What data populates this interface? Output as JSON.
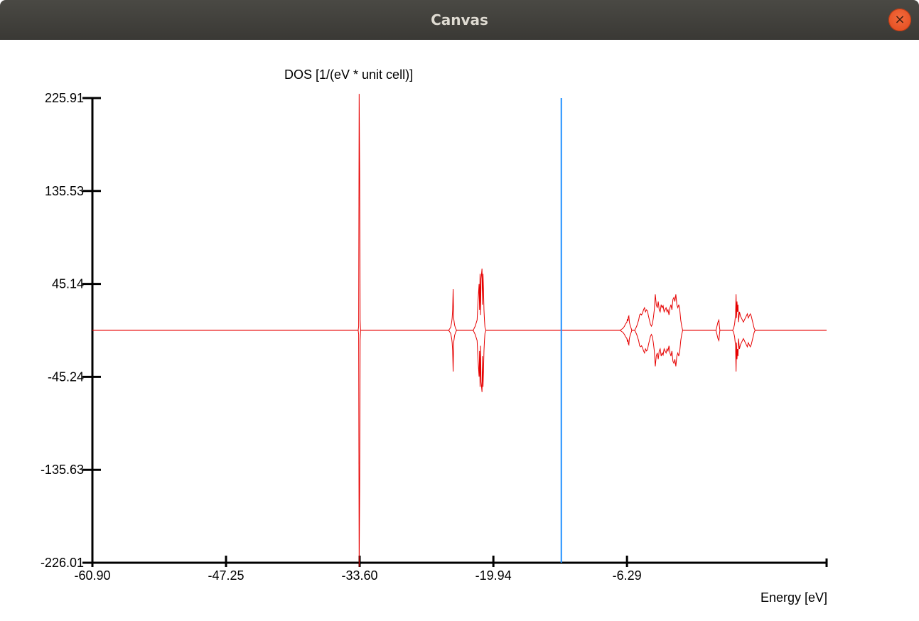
{
  "window": {
    "title": "Canvas",
    "close_icon": "close-icon",
    "close_glyph": "×"
  },
  "colors": {
    "titlebar": "#3d3c38",
    "close_button": "#e95420",
    "dos_curve": "#e60000",
    "fermi_line": "#1e90ff",
    "axis": "#000000"
  },
  "chart_data": {
    "type": "line",
    "title": "",
    "ylabel": "DOS [1/(eV * unit cell)]",
    "xlabel": "Energy [eV]",
    "xlim": [
      -60.9,
      14.1
    ],
    "ylim": [
      -226.01,
      225.91
    ],
    "x_ticks": [
      -60.9,
      -47.25,
      -33.6,
      -19.94,
      -6.29
    ],
    "x_tick_labels": [
      "-60.90",
      "-47.25",
      "-33.60",
      "-19.94",
      "-6.29"
    ],
    "y_ticks": [
      225.91,
      135.53,
      45.14,
      -45.24,
      -135.63,
      -226.01
    ],
    "y_tick_labels": [
      "225.91",
      "135.53",
      "45.14",
      "-45.24",
      "-135.63",
      "-226.01"
    ],
    "grid": false,
    "fermi_level": {
      "x": -13.0,
      "color": "#1e90ff"
    },
    "series": [
      {
        "color": "#e60000",
        "spin_up": [
          [
            -60.9,
            0
          ],
          [
            -33.75,
            0
          ],
          [
            -33.7,
            4
          ],
          [
            -33.65,
            230
          ],
          [
            -33.6,
            155
          ],
          [
            -33.55,
            10
          ],
          [
            -33.5,
            0
          ],
          [
            -24.5,
            0
          ],
          [
            -24.3,
            3
          ],
          [
            -24.2,
            8
          ],
          [
            -24.15,
            12
          ],
          [
            -24.1,
            20
          ],
          [
            -24.05,
            40
          ],
          [
            -24.0,
            12
          ],
          [
            -23.9,
            5
          ],
          [
            -23.8,
            2
          ],
          [
            -23.7,
            0
          ],
          [
            -22.0,
            0
          ],
          [
            -21.8,
            4
          ],
          [
            -21.6,
            10
          ],
          [
            -21.5,
            30
          ],
          [
            -21.4,
            45
          ],
          [
            -21.35,
            20
          ],
          [
            -21.3,
            55
          ],
          [
            -21.25,
            15
          ],
          [
            -21.2,
            50
          ],
          [
            -21.1,
            60
          ],
          [
            -21.05,
            25
          ],
          [
            -21.0,
            55
          ],
          [
            -20.95,
            40
          ],
          [
            -20.9,
            20
          ],
          [
            -20.85,
            10
          ],
          [
            -20.8,
            3
          ],
          [
            -20.7,
            0
          ],
          [
            -7.0,
            0
          ],
          [
            -6.85,
            1
          ],
          [
            -6.7,
            2
          ],
          [
            -6.55,
            4
          ],
          [
            -6.45,
            6
          ],
          [
            -6.3,
            8
          ],
          [
            -6.25,
            11
          ],
          [
            -6.2,
            9
          ],
          [
            -6.15,
            13
          ],
          [
            -6.1,
            14
          ],
          [
            -6.05,
            8
          ],
          [
            -6.0,
            6
          ],
          [
            -5.9,
            3
          ],
          [
            -5.8,
            0
          ],
          [
            -5.5,
            0
          ],
          [
            -5.3,
            4
          ],
          [
            -5.1,
            10
          ],
          [
            -5.0,
            15
          ],
          [
            -4.9,
            16
          ],
          [
            -4.8,
            15
          ],
          [
            -4.7,
            17
          ],
          [
            -4.6,
            20
          ],
          [
            -4.5,
            22
          ],
          [
            -4.4,
            18
          ],
          [
            -4.3,
            20
          ],
          [
            -4.2,
            19
          ],
          [
            -4.1,
            14
          ],
          [
            -4.0,
            10
          ],
          [
            -3.9,
            6
          ],
          [
            -3.8,
            4
          ],
          [
            -3.7,
            6
          ],
          [
            -3.6,
            12
          ],
          [
            -3.5,
            20
          ],
          [
            -3.4,
            35
          ],
          [
            -3.3,
            25
          ],
          [
            -3.2,
            22
          ],
          [
            -3.1,
            28
          ],
          [
            -3.0,
            20
          ],
          [
            -2.9,
            18
          ],
          [
            -2.8,
            25
          ],
          [
            -2.7,
            22
          ],
          [
            -2.6,
            24
          ],
          [
            -2.5,
            18
          ],
          [
            -2.4,
            20
          ],
          [
            -2.3,
            22
          ],
          [
            -2.2,
            18
          ],
          [
            -2.1,
            20
          ],
          [
            -2.0,
            15
          ],
          [
            -1.9,
            22
          ],
          [
            -1.8,
            25
          ],
          [
            -1.7,
            20
          ],
          [
            -1.6,
            30
          ],
          [
            -1.5,
            32
          ],
          [
            -1.4,
            28
          ],
          [
            -1.3,
            35
          ],
          [
            -1.2,
            25
          ],
          [
            -1.1,
            22
          ],
          [
            -1.0,
            25
          ],
          [
            -0.9,
            20
          ],
          [
            -0.8,
            10
          ],
          [
            -0.7,
            4
          ],
          [
            -0.6,
            0
          ],
          [
            2.8,
            0
          ],
          [
            2.9,
            4
          ],
          [
            3.0,
            8
          ],
          [
            3.1,
            10
          ],
          [
            3.15,
            4
          ],
          [
            3.2,
            0
          ],
          [
            4.5,
            0
          ],
          [
            4.6,
            2
          ],
          [
            4.7,
            6
          ],
          [
            4.8,
            15
          ],
          [
            4.85,
            35
          ],
          [
            4.9,
            12
          ],
          [
            4.95,
            28
          ],
          [
            5.0,
            18
          ],
          [
            5.05,
            25
          ],
          [
            5.1,
            8
          ],
          [
            5.2,
            18
          ],
          [
            5.3,
            14
          ],
          [
            5.4,
            12
          ],
          [
            5.5,
            10
          ],
          [
            5.6,
            8
          ],
          [
            5.7,
            10
          ],
          [
            5.8,
            12
          ],
          [
            5.9,
            14
          ],
          [
            6.0,
            16
          ],
          [
            6.1,
            12
          ],
          [
            6.2,
            14
          ],
          [
            6.3,
            16
          ],
          [
            6.4,
            14
          ],
          [
            6.5,
            10
          ],
          [
            6.6,
            6
          ],
          [
            6.7,
            2
          ],
          [
            6.8,
            0
          ],
          [
            14.1,
            0
          ]
        ],
        "spin_down": [
          [
            -60.9,
            0
          ],
          [
            -33.75,
            0
          ],
          [
            -33.7,
            -4
          ],
          [
            -33.65,
            -230
          ],
          [
            -33.6,
            -155
          ],
          [
            -33.55,
            -10
          ],
          [
            -33.5,
            0
          ],
          [
            -24.5,
            0
          ],
          [
            -24.3,
            -3
          ],
          [
            -24.2,
            -8
          ],
          [
            -24.15,
            -12
          ],
          [
            -24.1,
            -20
          ],
          [
            -24.05,
            -40
          ],
          [
            -24.0,
            -12
          ],
          [
            -23.9,
            -5
          ],
          [
            -23.8,
            -2
          ],
          [
            -23.7,
            0
          ],
          [
            -22.0,
            0
          ],
          [
            -21.8,
            -4
          ],
          [
            -21.6,
            -10
          ],
          [
            -21.5,
            -30
          ],
          [
            -21.4,
            -45
          ],
          [
            -21.35,
            -20
          ],
          [
            -21.3,
            -55
          ],
          [
            -21.25,
            -15
          ],
          [
            -21.2,
            -50
          ],
          [
            -21.1,
            -60
          ],
          [
            -21.05,
            -25
          ],
          [
            -21.0,
            -55
          ],
          [
            -20.95,
            -40
          ],
          [
            -20.9,
            -20
          ],
          [
            -20.85,
            -10
          ],
          [
            -20.8,
            -3
          ],
          [
            -20.7,
            0
          ],
          [
            -7.0,
            0
          ],
          [
            -6.85,
            -1
          ],
          [
            -6.7,
            -2
          ],
          [
            -6.55,
            -4
          ],
          [
            -6.45,
            -6
          ],
          [
            -6.3,
            -8
          ],
          [
            -6.25,
            -11
          ],
          [
            -6.2,
            -9
          ],
          [
            -6.15,
            -13
          ],
          [
            -6.1,
            -14
          ],
          [
            -6.05,
            -8
          ],
          [
            -6.0,
            -6
          ],
          [
            -5.9,
            -3
          ],
          [
            -5.8,
            0
          ],
          [
            -5.5,
            0
          ],
          [
            -5.3,
            -4
          ],
          [
            -5.1,
            -10
          ],
          [
            -5.0,
            -15
          ],
          [
            -4.9,
            -16
          ],
          [
            -4.8,
            -15
          ],
          [
            -4.7,
            -17
          ],
          [
            -4.6,
            -20
          ],
          [
            -4.5,
            -22
          ],
          [
            -4.4,
            -18
          ],
          [
            -4.3,
            -20
          ],
          [
            -4.2,
            -19
          ],
          [
            -4.1,
            -14
          ],
          [
            -4.0,
            -10
          ],
          [
            -3.9,
            -6
          ],
          [
            -3.8,
            -4
          ],
          [
            -3.7,
            -6
          ],
          [
            -3.6,
            -12
          ],
          [
            -3.5,
            -20
          ],
          [
            -3.4,
            -35
          ],
          [
            -3.3,
            -25
          ],
          [
            -3.2,
            -22
          ],
          [
            -3.1,
            -28
          ],
          [
            -3.0,
            -20
          ],
          [
            -2.9,
            -18
          ],
          [
            -2.8,
            -25
          ],
          [
            -2.7,
            -22
          ],
          [
            -2.6,
            -24
          ],
          [
            -2.5,
            -18
          ],
          [
            -2.4,
            -20
          ],
          [
            -2.3,
            -22
          ],
          [
            -2.2,
            -18
          ],
          [
            -2.1,
            -20
          ],
          [
            -2.0,
            -15
          ],
          [
            -1.9,
            -22
          ],
          [
            -1.8,
            -25
          ],
          [
            -1.7,
            -20
          ],
          [
            -1.6,
            -30
          ],
          [
            -1.5,
            -32
          ],
          [
            -1.4,
            -28
          ],
          [
            -1.3,
            -35
          ],
          [
            -1.2,
            -25
          ],
          [
            -1.1,
            -22
          ],
          [
            -1.0,
            -25
          ],
          [
            -0.9,
            -20
          ],
          [
            -0.8,
            -10
          ],
          [
            -0.7,
            -4
          ],
          [
            -0.6,
            0
          ],
          [
            2.8,
            0
          ],
          [
            2.9,
            -4
          ],
          [
            3.0,
            -8
          ],
          [
            3.1,
            -10
          ],
          [
            3.15,
            -4
          ],
          [
            3.2,
            0
          ],
          [
            4.5,
            0
          ],
          [
            4.6,
            -2
          ],
          [
            4.7,
            -6
          ],
          [
            4.8,
            -15
          ],
          [
            4.85,
            -40
          ],
          [
            4.9,
            -12
          ],
          [
            4.95,
            -28
          ],
          [
            5.0,
            -18
          ],
          [
            5.05,
            -25
          ],
          [
            5.1,
            -8
          ],
          [
            5.2,
            -18
          ],
          [
            5.3,
            -14
          ],
          [
            5.4,
            -12
          ],
          [
            5.5,
            -10
          ],
          [
            5.6,
            -8
          ],
          [
            5.7,
            -10
          ],
          [
            5.8,
            -12
          ],
          [
            5.9,
            -14
          ],
          [
            6.0,
            -16
          ],
          [
            6.1,
            -12
          ],
          [
            6.2,
            -14
          ],
          [
            6.3,
            -16
          ],
          [
            6.4,
            -14
          ],
          [
            6.5,
            -10
          ],
          [
            6.6,
            -6
          ],
          [
            6.7,
            -2
          ],
          [
            6.8,
            0
          ],
          [
            14.1,
            0
          ]
        ]
      }
    ]
  }
}
